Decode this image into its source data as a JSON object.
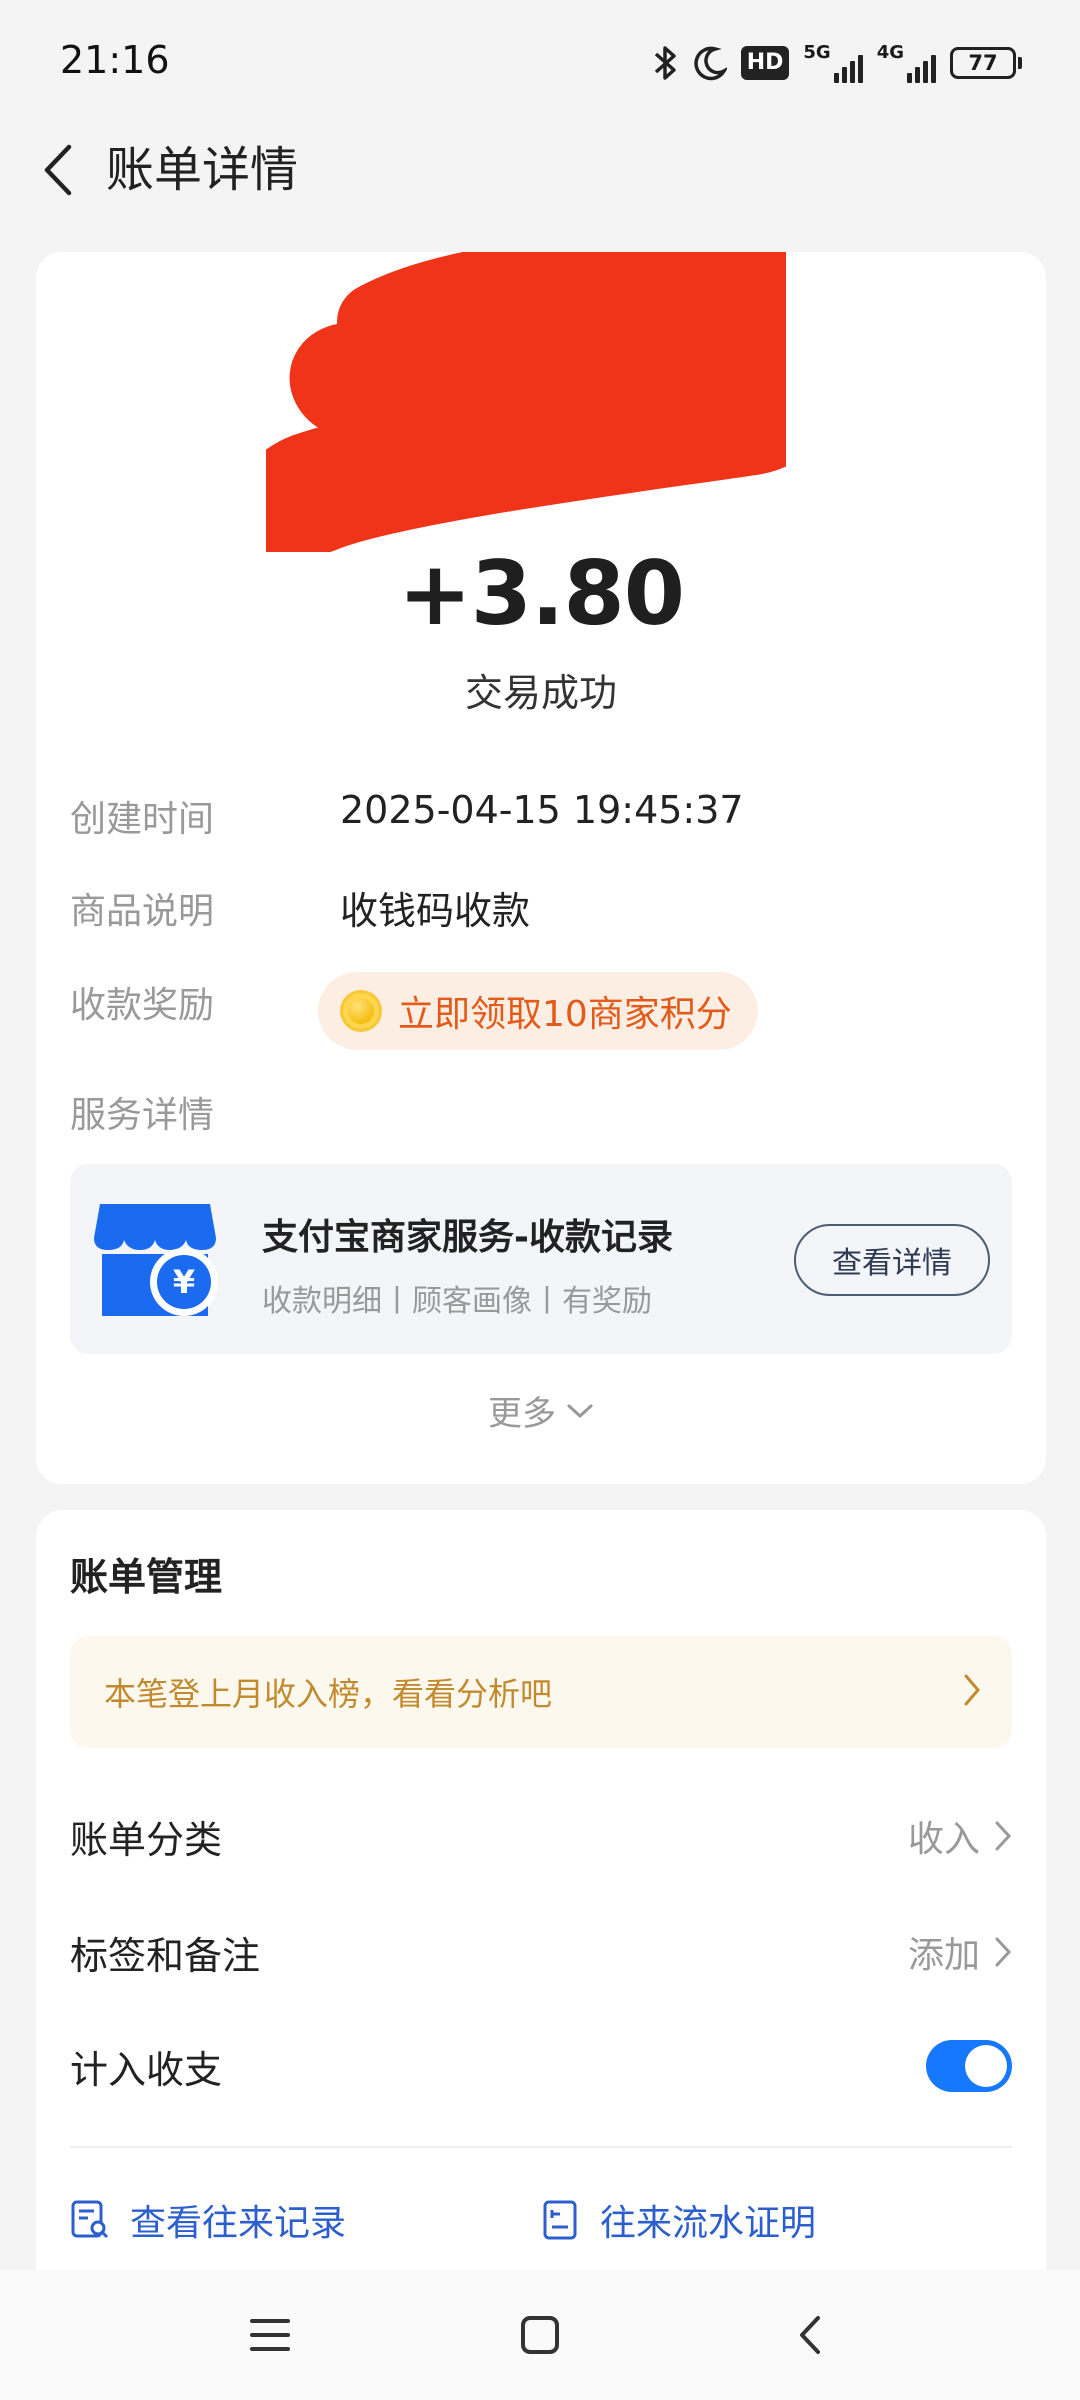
{
  "status_bar": {
    "time": "21:16",
    "hd_label": "HD",
    "net1_label": "5G",
    "net2_label": "4G",
    "battery": "77"
  },
  "header": {
    "title": "账单详情"
  },
  "transaction": {
    "amount": "+3.80",
    "status": "交易成功",
    "rows": [
      {
        "label": "创建时间",
        "value": "2025-04-15 19:45:37"
      },
      {
        "label": "商品说明",
        "value": "收钱码收款"
      },
      {
        "label": "收款奖励",
        "value": "立即领取10商家积分"
      },
      {
        "label": "服务详情",
        "value": ""
      }
    ]
  },
  "service": {
    "title": "支付宝商家服务-收款记录",
    "subtitle": "收款明细丨顾客画像丨有奖励",
    "button": "查看详情"
  },
  "more_label": "更多",
  "manage": {
    "title": "账单管理",
    "tip": "本笔登上月收入榜，看看分析吧",
    "category_label": "账单分类",
    "category_value": "收入",
    "tags_label": "标签和备注",
    "tags_value": "添加",
    "include_label": "计入收支",
    "include_on": true,
    "link_records": "查看往来记录",
    "link_proof": "往来流水证明"
  },
  "colors": {
    "accent": "#1677ff",
    "reward_text": "#e35b1a",
    "tip_text": "#c18a2e",
    "link": "#2c5fcd",
    "redaction": "#f0341a"
  }
}
